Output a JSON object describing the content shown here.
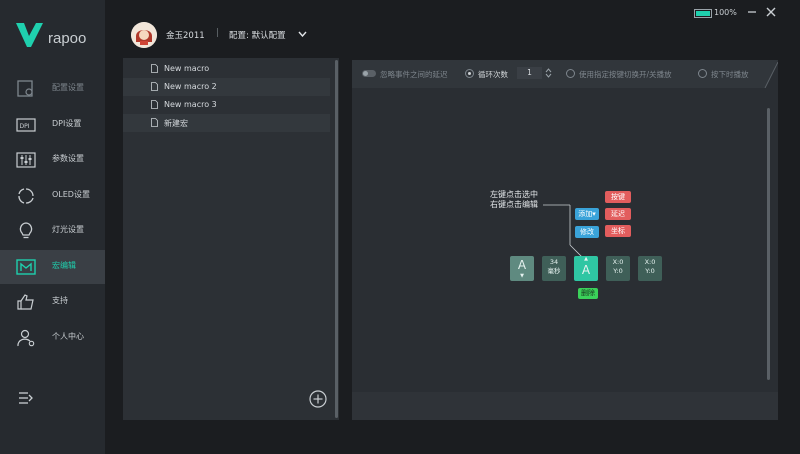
{
  "brand": {
    "name": "rapoo"
  },
  "header": {
    "username": "金玉2011",
    "separator": "|",
    "config_label": "配置: 默认配置",
    "battery": "100%",
    "battery_level": 1.0
  },
  "sidebar": {
    "items": [
      {
        "label": "配置设置",
        "icon": "profile-icon"
      },
      {
        "label": "DPI设置",
        "icon": "dpi-icon"
      },
      {
        "label": "参数设置",
        "icon": "sliders-icon"
      },
      {
        "label": "OLED设置",
        "icon": "cycle-icon"
      },
      {
        "label": "灯光设置",
        "icon": "lightbulb-icon"
      },
      {
        "label": "宏编辑",
        "icon": "macro-icon"
      },
      {
        "label": "支持",
        "icon": "thumbs-up-icon"
      },
      {
        "label": "个人中心",
        "icon": "user-settings-icon"
      }
    ],
    "collapse_icon": "collapse-menu-icon"
  },
  "macros": {
    "items": [
      "New macro",
      "New macro 2",
      "New macro 3",
      "新建宏"
    ]
  },
  "editor": {
    "toolbar": {
      "ignore_delay": "忽略事件之间的延迟",
      "loop_count_label": "循环次数",
      "loop_count": "1",
      "toggle_mode": "使用指定按键切换开/关播放",
      "hold_mode": "按下时播放"
    },
    "hint": {
      "line1": "左键点击选中",
      "line2": "右键点击编辑"
    },
    "menu": {
      "add": "添加▾",
      "modify": "修改",
      "press": "按键",
      "delay": "延迟",
      "coordinate": "坐标"
    },
    "sequence": {
      "key_a": "A",
      "delay_value": "34",
      "delay_unit": "毫秒",
      "key_a_active": "A",
      "coord1_x": "X:0",
      "coord1_y": "Y:0",
      "coord2_x": "X:0",
      "coord2_y": "Y:0",
      "delete": "删除"
    }
  }
}
